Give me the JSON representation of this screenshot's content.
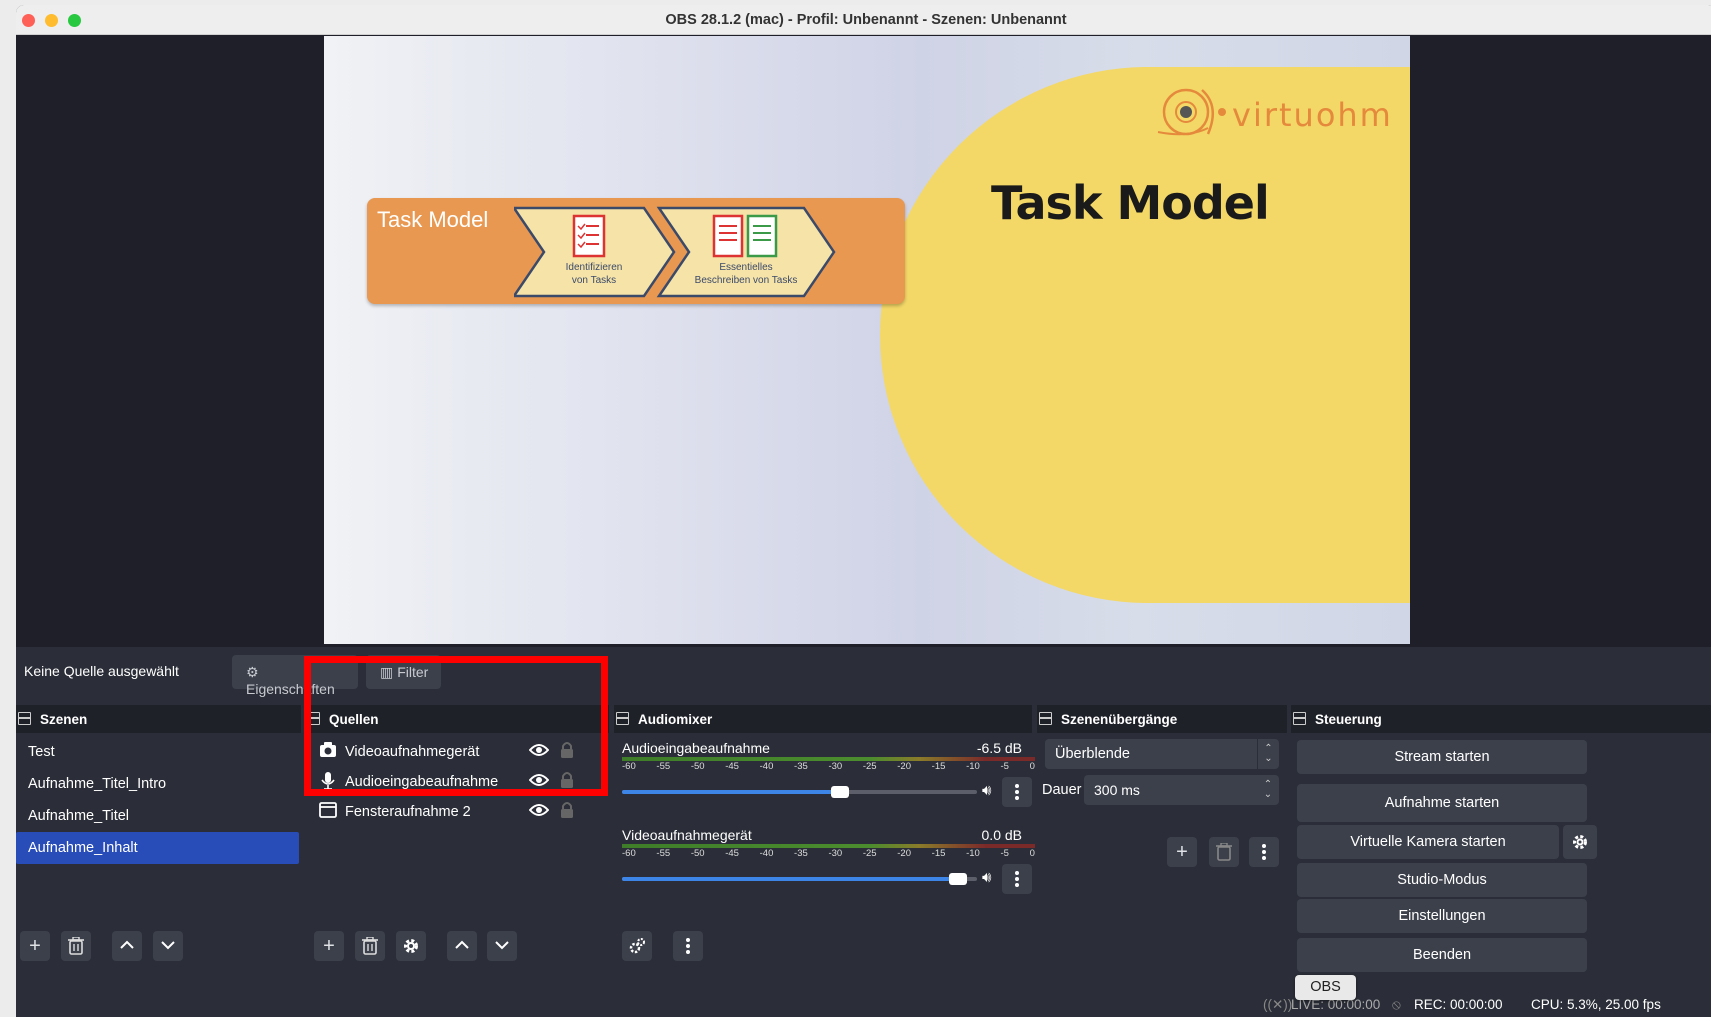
{
  "window": {
    "title": "OBS 28.1.2 (mac) - Profil: Unbenannt - Szenen: Unbenannt"
  },
  "preview": {
    "slide_banner_title": "Task Model",
    "chevron_1_label_line1": "Identifizieren",
    "chevron_1_label_line2": "von Tasks",
    "chevron_2_label_line1": "Essentielles",
    "chevron_2_label_line2": "Beschreiben von Tasks",
    "logo_text": "virtuohm",
    "slide_heading": "Task Model",
    "colors": {
      "accent_yellow": "#f3d867",
      "banner_orange": "#e89850",
      "logo_orange": "#e58a3c"
    }
  },
  "source_toolbar": {
    "status": "Keine Quelle ausgewählt",
    "properties_label": "Eigenschaften",
    "filter_label": "Filter",
    "properties_icon": "gear-icon",
    "filter_icon": "filter-icon"
  },
  "scenes": {
    "title": "Szenen",
    "items": [
      "Test",
      "Aufnahme_Titel_Intro",
      "Aufnahme_Titel",
      "Aufnahme_Inhalt"
    ],
    "selected": "Aufnahme_Inhalt"
  },
  "sources": {
    "title": "Quellen",
    "items": [
      {
        "label": "Videoaufnahmegerät",
        "icon": "camera-icon",
        "visible": true,
        "locked": false
      },
      {
        "label": "Audioeingabeaufnahme",
        "icon": "microphone-icon",
        "visible": true,
        "locked": false
      },
      {
        "label": "Fensteraufnahme 2",
        "icon": "window-icon",
        "visible": true,
        "locked": false
      }
    ],
    "highlight_color": "#fe0000"
  },
  "audiomixer": {
    "title": "Audiomixer",
    "channels": [
      {
        "name": "Audioeingabeaufnahme",
        "level": "-6.5 dB",
        "volume_fraction": 0.62
      },
      {
        "name": "Videoaufnahmegerät",
        "level": "0.0 dB",
        "volume_fraction": 0.97
      }
    ],
    "ticks": [
      "-60",
      "-55",
      "-50",
      "-45",
      "-40",
      "-35",
      "-30",
      "-25",
      "-20",
      "-15",
      "-10",
      "-5",
      "0"
    ]
  },
  "transitions": {
    "title": "Szenenübergänge",
    "selected": "Überblende",
    "duration_label": "Dauer",
    "duration_value": "300 ms"
  },
  "controls": {
    "title": "Steuerung",
    "stream": "Stream starten",
    "record": "Aufnahme starten",
    "virtual_camera": "Virtuelle Kamera starten",
    "studio_mode": "Studio-Modus",
    "settings": "Einstellungen",
    "exit": "Beenden"
  },
  "statusbar": {
    "live": "LIVE: 00:00:00",
    "rec": "REC: 00:00:00",
    "cpu": "CPU: 5.3%, 25.00 fps",
    "tooltip": "OBS"
  }
}
